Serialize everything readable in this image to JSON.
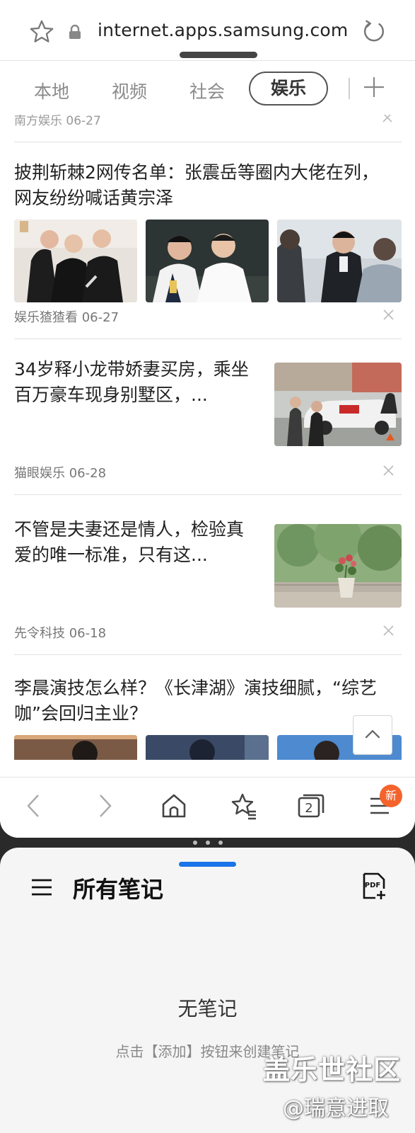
{
  "browser": {
    "url": "internet.apps.samsung.com",
    "tabs": [
      "本地",
      "视频",
      "社会",
      "娱乐"
    ],
    "active_tab": "娱乐",
    "icons": [
      "star-icon",
      "lock-icon",
      "reload-icon",
      "plus-icon"
    ]
  },
  "feed": {
    "cut_meta": "南方娱乐 06-27",
    "articles": [
      {
        "title": "披荆斩棘2网传名单：张震岳等圈内大佬在列，网友纷纷喊话黄宗泽",
        "source": "娱乐猹猹看",
        "date": "06-27",
        "meta": "娱乐猹猹看 06-27"
      },
      {
        "title": "34岁释小龙带娇妻买房，乘坐百万豪车现身别墅区，...",
        "source": "猫眼娱乐",
        "date": "06-28",
        "meta": "猫眼娱乐 06-28"
      },
      {
        "title": "不管是夫妻还是情人，检验真爱的唯一标准，只有这...",
        "source": "先令科技",
        "date": "06-18",
        "meta": "先令科技 06-18"
      },
      {
        "title": "李晨演技怎么样？《长津湖》演技细腻，“综艺咖”会回归主业？",
        "source": "",
        "date": "",
        "meta": ""
      }
    ]
  },
  "bottom_bar": {
    "icons": [
      "back-icon",
      "forward-icon",
      "home-icon",
      "bookmarks-icon",
      "tabs-icon",
      "menu-icon"
    ],
    "tab_count": "2",
    "badge": "新"
  },
  "notes": {
    "title": "所有笔记",
    "empty_title": "无笔记",
    "empty_hint": "点击【添加】按钮来创建笔记",
    "pdf_label": "PDF"
  },
  "watermark": {
    "line1": "盖乐世社区",
    "line2": "@瑞意进取"
  },
  "colors": {
    "accent": "#1a73e8",
    "badge": "#f4632b",
    "text": "#222222",
    "meta": "#777777"
  }
}
